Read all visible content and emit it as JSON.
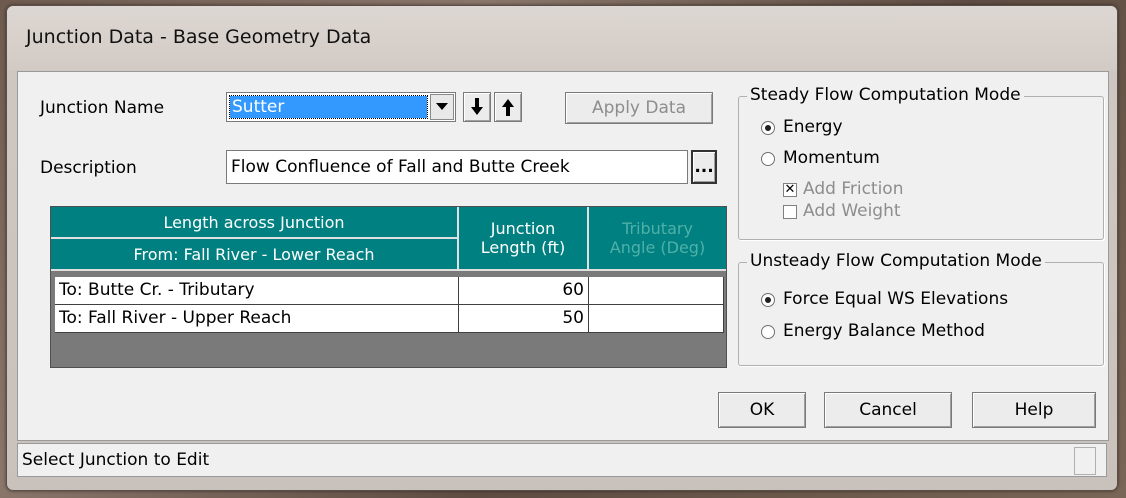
{
  "window": {
    "title": "Junction Data - Base Geometry Data"
  },
  "junction": {
    "name_label": "Junction Name",
    "name_value": "Sutter",
    "apply_label": "Apply Data",
    "description_label": "Description",
    "description_value": "Flow Confluence of Fall and Butte Creek",
    "ellipsis": "..."
  },
  "grid": {
    "header_length_across": "Length across Junction",
    "header_from": "From: Fall River - Lower Reach",
    "header_junction_length": "Junction Length (ft)",
    "header_tributary_angle": "Tributary Angle (Deg)",
    "rows": [
      {
        "to": "To: Butte Cr. - Tributary",
        "length": "60",
        "angle": ""
      },
      {
        "to": "To: Fall River - Upper Reach",
        "length": "50",
        "angle": ""
      }
    ]
  },
  "steady": {
    "title": "Steady Flow Computation Mode",
    "energy": "Energy",
    "momentum": "Momentum",
    "add_friction": "Add Friction",
    "add_weight": "Add Weight",
    "selected": "energy",
    "add_friction_checked": true,
    "add_weight_checked": false
  },
  "unsteady": {
    "title": "Unsteady Flow Computation Mode",
    "force_equal": "Force Equal WS Elevations",
    "energy_balance": "Energy Balance Method",
    "selected": "force_equal"
  },
  "buttons": {
    "ok": "OK",
    "cancel": "Cancel",
    "help": "Help"
  },
  "status": {
    "text": "Select Junction to Edit"
  },
  "icons": {
    "dropdown": "chevron-down-icon",
    "down": "arrow-down-icon",
    "up": "arrow-up-icon"
  }
}
